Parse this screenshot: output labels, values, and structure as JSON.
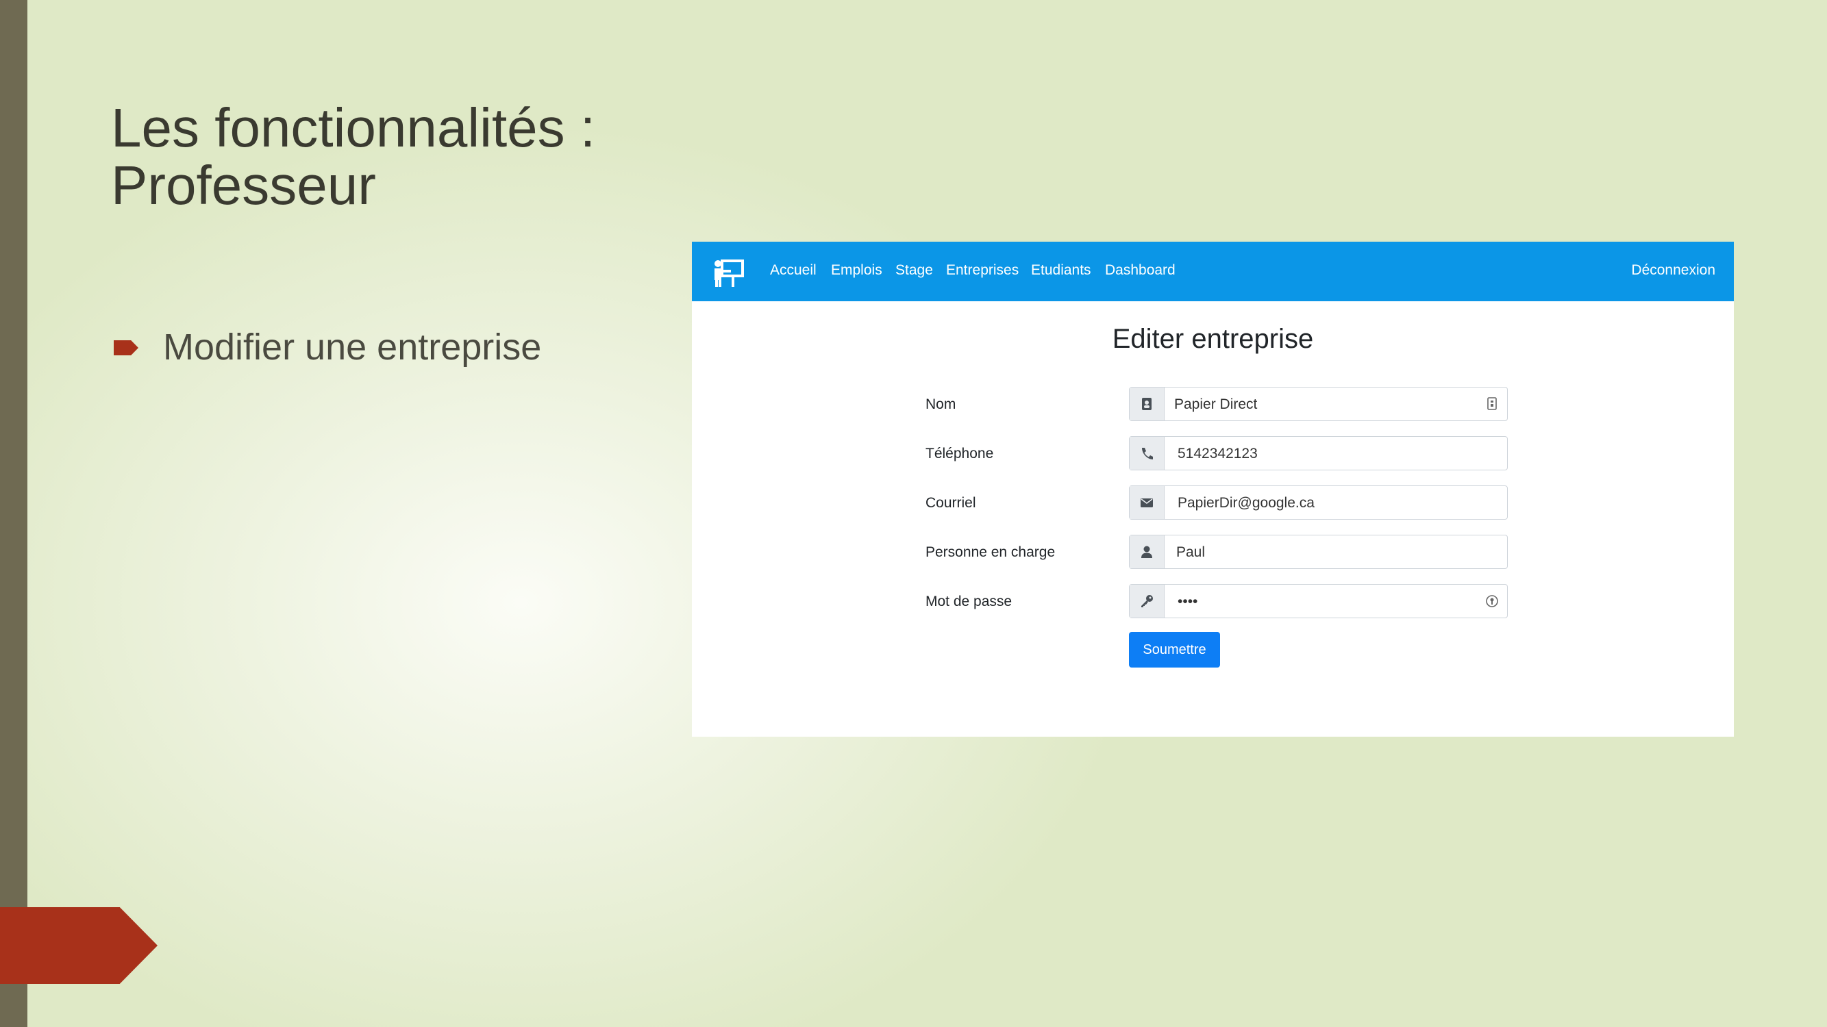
{
  "slide": {
    "title_line1": "Les fonctionnalités :",
    "title_line2": "Professeur",
    "bullet": "Modifier une entreprise"
  },
  "app": {
    "nav": {
      "brand_icon": "teacher-board-icon",
      "items": [
        "Accueil",
        "Emplois",
        "Stage",
        "Entreprises",
        "Etudiants",
        "Dashboard"
      ],
      "logout": "Déconnexion"
    },
    "form": {
      "title": "Editer entreprise",
      "fields": [
        {
          "label": "Nom",
          "value": "Papier Direct",
          "icon": "contact-card-icon"
        },
        {
          "label": "Téléphone",
          "value": "5142342123",
          "icon": "phone-icon"
        },
        {
          "label": "Courriel",
          "value": "PapierDir@google.ca",
          "icon": "envelope-icon"
        },
        {
          "label": "Personne en charge",
          "value": "Paul",
          "icon": "user-icon"
        },
        {
          "label": "Mot de passe",
          "value": "••••",
          "icon": "key-icon"
        }
      ],
      "submit": "Soumettre"
    }
  },
  "colors": {
    "accent": "#a8311a",
    "navbar": "#0b96e7",
    "button": "#0d7ef5",
    "sidebar": "#6f6a52"
  }
}
